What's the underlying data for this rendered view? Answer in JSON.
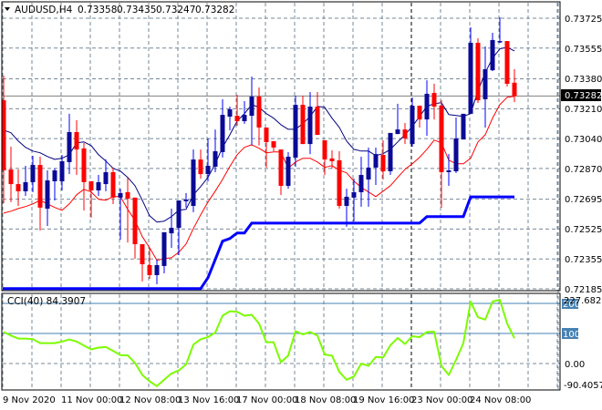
{
  "header": {
    "symbol": "AUDUSD,H4",
    "open": "0.73358",
    "high": "0.73435",
    "low": "0.73247",
    "close": "0.73282",
    "menu_icon": "triangle-down-icon"
  },
  "colors": {
    "bull_body": "#0a0a96",
    "bull_wick": "#0000ff",
    "bear": "#ff0000",
    "ma_fast": "#000080",
    "ma_slow": "#ff0000",
    "step_line": "#0000ff",
    "cci": "#7cfc00",
    "grid": "#778899",
    "level": "#4682b4"
  },
  "chart_data": [
    {
      "type": "candlestick",
      "title": "AUDUSD,H4",
      "ylim": [
        0.72185,
        0.73725
      ],
      "y_ticks": [
        "0.73725",
        "0.73555",
        "0.73380",
        "0.73210",
        "0.73040",
        "0.72870",
        "0.72695",
        "0.72525",
        "0.72355",
        "0.72185"
      ],
      "current_price": "0.73282",
      "x_ticks": [
        "9 Nov 2020",
        "11 Nov 00:00",
        "12 Nov 08:00",
        "13 Nov 16:00",
        "17 Nov 00:00",
        "18 Nov 08:00",
        "19 Nov 16:00",
        "23 Nov 00:00",
        "24 Nov 08:00"
      ],
      "ohlc": [
        [
          0.73258,
          0.73398,
          0.72672,
          0.72859
        ],
        [
          0.72864,
          0.72994,
          0.72678,
          0.72781
        ],
        [
          0.72781,
          0.72864,
          0.72657,
          0.7274
        ],
        [
          0.7274,
          0.72885,
          0.72714,
          0.72792
        ],
        [
          0.72792,
          0.72942,
          0.72735,
          0.7289
        ],
        [
          0.7289,
          0.72937,
          0.72517,
          0.72647
        ],
        [
          0.72641,
          0.72859,
          0.72543,
          0.72802
        ],
        [
          0.72797,
          0.7287,
          0.72688,
          0.72859
        ],
        [
          0.72797,
          0.72947,
          0.72745,
          0.72911
        ],
        [
          0.72906,
          0.73181,
          0.72838,
          0.73077
        ],
        [
          0.73077,
          0.73144,
          0.72833,
          0.72978
        ],
        [
          0.72984,
          0.73015,
          0.72631,
          0.72792
        ],
        [
          0.72797,
          0.72797,
          0.7259,
          0.72745
        ],
        [
          0.72745,
          0.72833,
          0.72714,
          0.72792
        ],
        [
          0.72781,
          0.72921,
          0.7274,
          0.72849
        ],
        [
          0.72849,
          0.72875,
          0.72667,
          0.72704
        ],
        [
          0.72704,
          0.72755,
          0.72465,
          0.7273
        ],
        [
          0.72735,
          0.72818,
          0.72449,
          0.72698
        ],
        [
          0.72704,
          0.72704,
          0.72356,
          0.72439
        ],
        [
          0.72439,
          0.72439,
          0.72227,
          0.72325
        ],
        [
          0.7232,
          0.72418,
          0.72242,
          0.72263
        ],
        [
          0.72263,
          0.72351,
          0.72211,
          0.7232
        ],
        [
          0.72315,
          0.72507,
          0.72273,
          0.72507
        ],
        [
          0.72501,
          0.72641,
          0.72418,
          0.72532
        ],
        [
          0.72532,
          0.72688,
          0.72377,
          0.72688
        ],
        [
          0.72683,
          0.7273,
          0.72647,
          0.72693
        ],
        [
          0.72657,
          0.72978,
          0.72621,
          0.72921
        ],
        [
          0.72921,
          0.72978,
          0.72812,
          0.72838
        ],
        [
          0.72838,
          0.73041,
          0.72797,
          0.72885
        ],
        [
          0.7288,
          0.73092,
          0.72849,
          0.72968
        ],
        [
          0.72963,
          0.73264,
          0.72932,
          0.73175
        ],
        [
          0.73165,
          0.73222,
          0.73087,
          0.73207
        ],
        [
          0.7317,
          0.73289,
          0.73113,
          0.73139
        ],
        [
          0.73139,
          0.73253,
          0.73124,
          0.73175
        ],
        [
          0.7317,
          0.73393,
          0.73001,
          0.73279
        ],
        [
          0.73279,
          0.73331,
          0.73001,
          0.73103
        ],
        [
          0.73103,
          0.73103,
          0.72875,
          0.7302
        ],
        [
          0.73025,
          0.73025,
          0.72968,
          0.72989
        ],
        [
          0.72978,
          0.72978,
          0.72719,
          0.72771
        ],
        [
          0.72771,
          0.72963,
          0.72755,
          0.72937
        ],
        [
          0.72932,
          0.73284,
          0.7288,
          0.73232
        ],
        [
          0.73232,
          0.73284,
          0.73009,
          0.73009
        ],
        [
          0.73009,
          0.73305,
          0.72952,
          0.73222
        ],
        [
          0.73222,
          0.73305,
          0.73061,
          0.73061
        ],
        [
          0.7303,
          0.7303,
          0.72833,
          0.72921
        ],
        [
          0.72927,
          0.72973,
          0.7287,
          0.72911
        ],
        [
          0.72916,
          0.72968,
          0.72641,
          0.72657
        ],
        [
          0.72657,
          0.72755,
          0.72538,
          0.72709
        ],
        [
          0.72704,
          0.72812,
          0.72569,
          0.72735
        ],
        [
          0.72735,
          0.72937,
          0.72652,
          0.72833
        ],
        [
          0.72807,
          0.72989,
          0.72652,
          0.72875
        ],
        [
          0.72875,
          0.72989,
          0.72776,
          0.72952
        ],
        [
          0.72947,
          0.7303,
          0.72807,
          0.72854
        ],
        [
          0.72854,
          0.73072,
          0.72833,
          0.73072
        ],
        [
          0.73066,
          0.73238,
          0.73066,
          0.73092
        ],
        [
          0.73092,
          0.73129,
          0.73009,
          0.73041
        ],
        [
          0.73009,
          0.73274,
          0.72994,
          0.73227
        ],
        [
          0.73227,
          0.73227,
          0.73103,
          0.73149
        ],
        [
          0.73149,
          0.73372,
          0.73056,
          0.73295
        ],
        [
          0.733,
          0.73352,
          0.73149,
          0.73222
        ],
        [
          0.73227,
          0.73258,
          0.72647,
          0.72849
        ],
        [
          0.72849,
          0.72952,
          0.72771,
          0.72859
        ],
        [
          0.72854,
          0.7316,
          0.72844,
          0.73041
        ],
        [
          0.73035,
          0.73181,
          0.73035,
          0.73181
        ],
        [
          0.73181,
          0.73673,
          0.73181,
          0.73585
        ],
        [
          0.73585,
          0.73611,
          0.73243,
          0.73258
        ],
        [
          0.73264,
          0.73564,
          0.73103,
          0.73435
        ],
        [
          0.73429,
          0.73642,
          0.73424,
          0.73601
        ],
        [
          0.7359,
          0.7373,
          0.73585,
          0.73595
        ],
        [
          0.73595,
          0.73595,
          0.73336,
          0.73352
        ],
        [
          0.73358,
          0.73435,
          0.73247,
          0.73282
        ]
      ],
      "ma_fast": [
        0.73088,
        0.73073,
        0.73026,
        0.7299,
        0.72969,
        0.72959,
        0.72938,
        0.72922,
        0.72928,
        0.72948,
        0.73016,
        0.73021,
        0.73,
        0.72948,
        0.72912,
        0.72871,
        0.72855,
        0.72819,
        0.72772,
        0.72689,
        0.72601,
        0.72565,
        0.7257,
        0.72596,
        0.72632,
        0.72637,
        0.7272,
        0.72767,
        0.72819,
        0.72897,
        0.7299,
        0.73062,
        0.7314,
        0.73182,
        0.73233,
        0.73218,
        0.73182,
        0.73156,
        0.73119,
        0.73093,
        0.73093,
        0.73125,
        0.73166,
        0.73223,
        0.73218,
        0.73156,
        0.73104,
        0.73026,
        0.72979,
        0.72969,
        0.72969,
        0.72943,
        0.72954,
        0.72979,
        0.73021,
        0.73062,
        0.73109,
        0.73166,
        0.73223,
        0.73239,
        0.73244,
        0.73177,
        0.73171,
        0.73166,
        0.73182,
        0.73311,
        0.73415,
        0.73498,
        0.7355,
        0.7356,
        0.73539
      ],
      "ma_slow": [
        0.72616,
        0.72627,
        0.72642,
        0.72653,
        0.72668,
        0.72689,
        0.72668,
        0.72648,
        0.72632,
        0.72668,
        0.7272,
        0.72751,
        0.72736,
        0.72694,
        0.72689,
        0.7271,
        0.7271,
        0.72637,
        0.72575,
        0.72482,
        0.72419,
        0.72347,
        0.72357,
        0.72362,
        0.72393,
        0.7244,
        0.72528,
        0.72606,
        0.72679,
        0.72741,
        0.72808,
        0.72881,
        0.72948,
        0.7299,
        0.73005,
        0.72985,
        0.72959,
        0.72964,
        0.72964,
        0.72871,
        0.72907,
        0.72928,
        0.72928,
        0.72907,
        0.72876,
        0.72886,
        0.7286,
        0.72845,
        0.72798,
        0.72762,
        0.72736,
        0.7271,
        0.72741,
        0.72772,
        0.72819,
        0.72865,
        0.72897,
        0.72933,
        0.72979,
        0.73031,
        0.73016,
        0.72917,
        0.72897,
        0.72897,
        0.72928,
        0.73021,
        0.73062,
        0.73156,
        0.73233,
        0.73275,
        0.7328
      ],
      "step_line": [
        0.72186,
        0.72186,
        0.72186,
        0.72186,
        0.72186,
        0.72186,
        0.72186,
        0.72186,
        0.72186,
        0.72186,
        0.72186,
        0.72186,
        0.72186,
        0.72186,
        0.72186,
        0.72186,
        0.72186,
        0.72186,
        0.72186,
        0.72186,
        0.72186,
        0.72186,
        0.72186,
        0.72186,
        0.72186,
        0.72186,
        0.72186,
        0.72186,
        0.72248,
        0.72352,
        0.72456,
        0.72471,
        0.72503,
        0.72503,
        0.72559,
        0.72559,
        0.72559,
        0.72559,
        0.72559,
        0.72559,
        0.72559,
        0.72559,
        0.72559,
        0.72559,
        0.72559,
        0.72559,
        0.72559,
        0.72559,
        0.72559,
        0.72559,
        0.72559,
        0.72559,
        0.72559,
        0.72559,
        0.72559,
        0.72559,
        0.72559,
        0.72559,
        0.72596,
        0.72596,
        0.72596,
        0.72596,
        0.72596,
        0.72596,
        0.72708,
        0.72708,
        0.72708,
        0.72708,
        0.72708,
        0.72708,
        0.72708
      ]
    },
    {
      "type": "line",
      "title": "CCI(40) 84.3907",
      "ylim": [
        -90.4057,
        227.6822
      ],
      "y_ticks": [
        "227.6822",
        "200",
        "100",
        "0.00",
        "-90.4057"
      ],
      "levels": [
        200,
        100
      ],
      "values": [
        105,
        93,
        83,
        83,
        81,
        68,
        68,
        68,
        73,
        80,
        73,
        60,
        47,
        53,
        55,
        42,
        28,
        27,
        2,
        -38,
        -59,
        -75,
        -54,
        -33,
        -23,
        -3,
        63,
        81,
        88,
        103,
        159,
        174,
        172,
        159,
        162,
        133,
        71,
        71,
        4,
        27,
        108,
        97,
        105,
        93,
        30,
        26,
        -28,
        -54,
        -43,
        0,
        -8,
        22,
        20,
        61,
        85,
        65,
        91,
        88,
        105,
        106,
        -8,
        -38,
        12,
        68,
        206,
        154,
        146,
        206,
        212,
        133,
        84.39
      ]
    }
  ]
}
